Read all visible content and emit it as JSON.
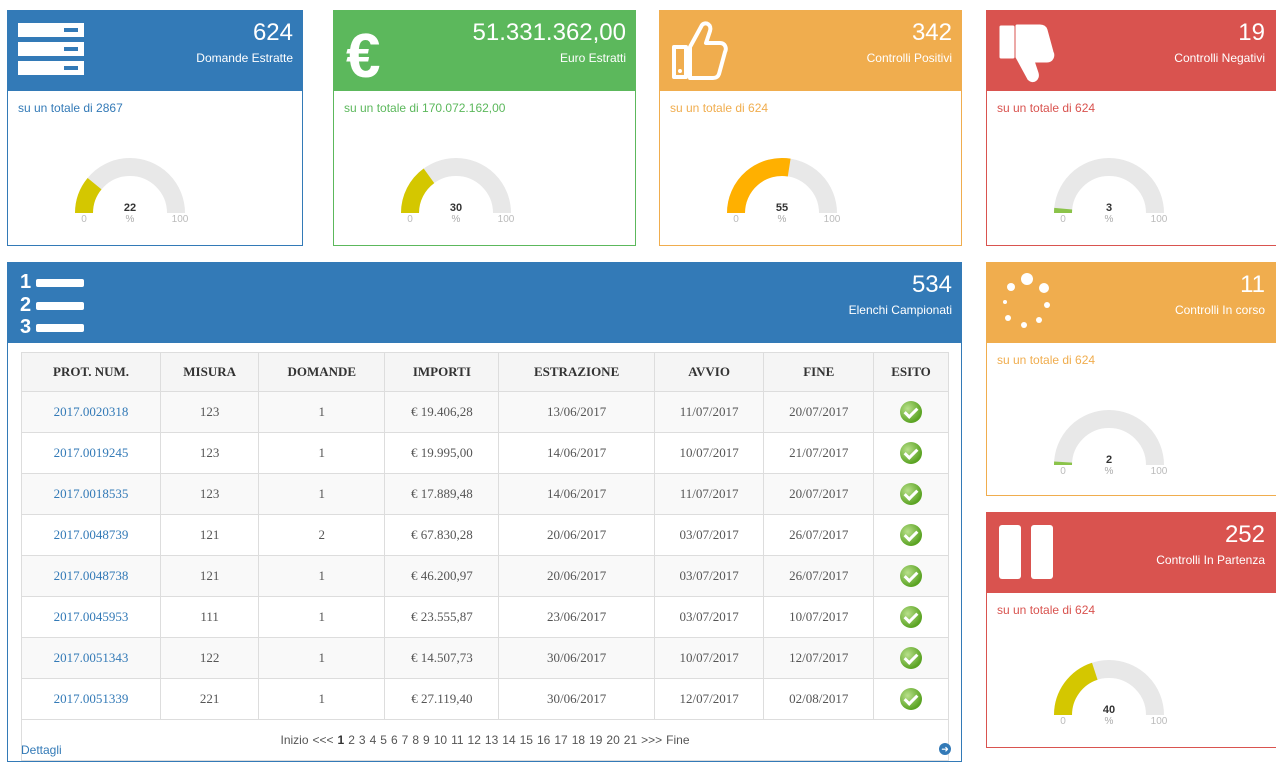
{
  "colors": {
    "blue": "#337ab7",
    "green": "#5cb85c",
    "orange": "#f0ad4e",
    "red": "#d9534f",
    "gauge_yellow": "#d4c700",
    "gauge_orange": "#ffb000",
    "gauge_green": "#8bc34a",
    "gauge_bg": "#e8e8e8"
  },
  "cards": [
    {
      "id": "domande",
      "value": "624",
      "label": "Domande Estratte",
      "total": "su un totale di 2867",
      "gauge": {
        "value": "22",
        "pct": 22,
        "unit": "%",
        "min": "0",
        "max": "100"
      },
      "icon": "server-list-icon"
    },
    {
      "id": "euro",
      "value": "51.331.362,00",
      "label": "Euro Estratti",
      "total": "su un totale di 170.072.162,00",
      "gauge": {
        "value": "30",
        "pct": 30,
        "unit": "%",
        "min": "0",
        "max": "100"
      },
      "icon": "euro-icon"
    },
    {
      "id": "positivi",
      "value": "342",
      "label": "Controlli Positivi",
      "total": "su un totale di 624",
      "gauge": {
        "value": "55",
        "pct": 55,
        "unit": "%",
        "min": "0",
        "max": "100"
      },
      "icon": "thumbs-up-icon"
    },
    {
      "id": "negativi",
      "value": "19",
      "label": "Controlli Negativi",
      "total": "su un totale di 624",
      "gauge": {
        "value": "3",
        "pct": 3,
        "unit": "%",
        "min": "0",
        "max": "100"
      },
      "icon": "thumbs-down-icon"
    },
    {
      "id": "incorso",
      "value": "11",
      "label": "Controlli In corso",
      "total": "su un totale di 624",
      "gauge": {
        "value": "2",
        "pct": 2,
        "unit": "%",
        "min": "0",
        "max": "100"
      },
      "icon": "spinner-icon"
    },
    {
      "id": "partenza",
      "value": "252",
      "label": "Controlli In Partenza",
      "total": "su un totale di 624",
      "gauge": {
        "value": "40",
        "pct": 40,
        "unit": "%",
        "min": "0",
        "max": "100"
      },
      "icon": "pause-icon"
    }
  ],
  "list": {
    "value": "534",
    "label": "Elenchi Campionati",
    "columns": [
      "PROT. NUM.",
      "MISURA",
      "DOMANDE",
      "IMPORTI",
      "ESTRAZIONE",
      "AVVIO",
      "FINE",
      "ESITO"
    ],
    "rows": [
      [
        "2017.0020318",
        "123",
        "1",
        "€ 19.406,28",
        "13/06/2017",
        "11/07/2017",
        "20/07/2017"
      ],
      [
        "2017.0019245",
        "123",
        "1",
        "€ 19.995,00",
        "14/06/2017",
        "10/07/2017",
        "21/07/2017"
      ],
      [
        "2017.0018535",
        "123",
        "1",
        "€ 17.889,48",
        "14/06/2017",
        "11/07/2017",
        "20/07/2017"
      ],
      [
        "2017.0048739",
        "121",
        "2",
        "€ 67.830,28",
        "20/06/2017",
        "03/07/2017",
        "26/07/2017"
      ],
      [
        "2017.0048738",
        "121",
        "1",
        "€ 46.200,97",
        "20/06/2017",
        "03/07/2017",
        "26/07/2017"
      ],
      [
        "2017.0045953",
        "111",
        "1",
        "€ 23.555,87",
        "23/06/2017",
        "03/07/2017",
        "10/07/2017"
      ],
      [
        "2017.0051343",
        "122",
        "1",
        "€ 14.507,73",
        "30/06/2017",
        "10/07/2017",
        "12/07/2017"
      ],
      [
        "2017.0051339",
        "221",
        "1",
        "€ 27.119,40",
        "30/06/2017",
        "12/07/2017",
        "02/08/2017"
      ]
    ],
    "pager": {
      "first": "Inizio",
      "prev": "<<<",
      "pages": [
        "1",
        "2",
        "3",
        "4",
        "5",
        "6",
        "7",
        "8",
        "9",
        "10",
        "11",
        "12",
        "13",
        "14",
        "15",
        "16",
        "17",
        "18",
        "19",
        "20",
        "21"
      ],
      "current": "1",
      "next": ">>>",
      "last": "Fine"
    },
    "details": "Dettagli"
  }
}
